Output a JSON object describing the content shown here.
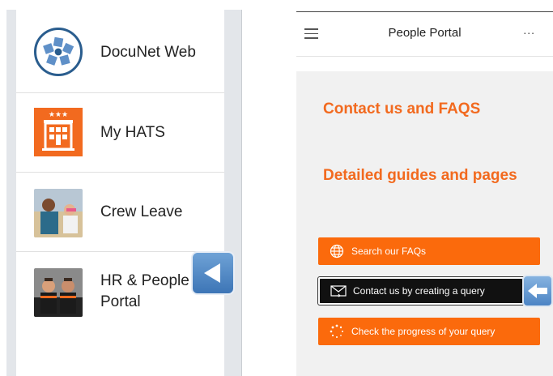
{
  "apps": [
    {
      "label": "DocuNet Web",
      "icon": "docunet-icon"
    },
    {
      "label": "My HATS",
      "icon": "hotel-icon"
    },
    {
      "label": "Crew Leave",
      "icon": "crew-leave-photo"
    },
    {
      "label": "HR & People\nPortal",
      "icon": "hr-people-photo"
    }
  ],
  "portal": {
    "title": "People Portal",
    "more": "...",
    "links": [
      "Contact us and FAQS",
      "Detailed guides and pages"
    ],
    "actions": [
      {
        "label": "Search our FAQs",
        "icon": "globe-icon"
      },
      {
        "label": "Contact us by creating a query",
        "icon": "envelope-icon"
      },
      {
        "label": "Check the progress of your query",
        "icon": "loading-icon"
      }
    ]
  },
  "colors": {
    "accent": "#fb6a0c",
    "link": "#f26a1f",
    "highlight": "#111111",
    "callout": "#4c84c4"
  }
}
